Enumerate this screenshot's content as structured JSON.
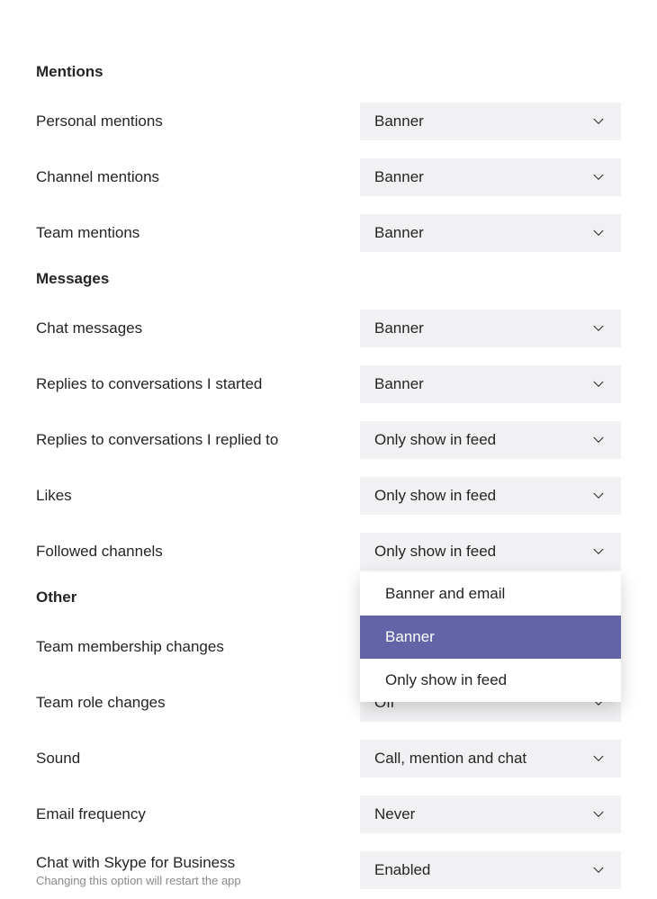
{
  "sections": {
    "mentions": {
      "heading": "Mentions",
      "items": [
        {
          "label": "Personal mentions",
          "value": "Banner"
        },
        {
          "label": "Channel mentions",
          "value": "Banner"
        },
        {
          "label": "Team mentions",
          "value": "Banner"
        }
      ]
    },
    "messages": {
      "heading": "Messages",
      "items": [
        {
          "label": "Chat messages",
          "value": "Banner"
        },
        {
          "label": "Replies to conversations I started",
          "value": "Banner"
        },
        {
          "label": "Replies to conversations I replied to",
          "value": "Only show in feed"
        },
        {
          "label": "Likes",
          "value": "Only show in feed"
        },
        {
          "label": "Followed channels",
          "value": "Only show in feed",
          "open": true,
          "options": [
            "Banner and email",
            "Banner",
            "Only show in feed"
          ],
          "selected_option": "Banner"
        }
      ]
    },
    "other": {
      "heading": "Other",
      "items": [
        {
          "label": "Team membership changes",
          "value": ""
        },
        {
          "label": "Team role changes",
          "value": "Off"
        },
        {
          "label": "Sound",
          "value": "Call, mention and chat"
        },
        {
          "label": "Email frequency",
          "value": "Never"
        },
        {
          "label": "Chat with Skype for Business",
          "sublabel": "Changing this option will restart the app",
          "value": "Enabled"
        }
      ]
    }
  }
}
